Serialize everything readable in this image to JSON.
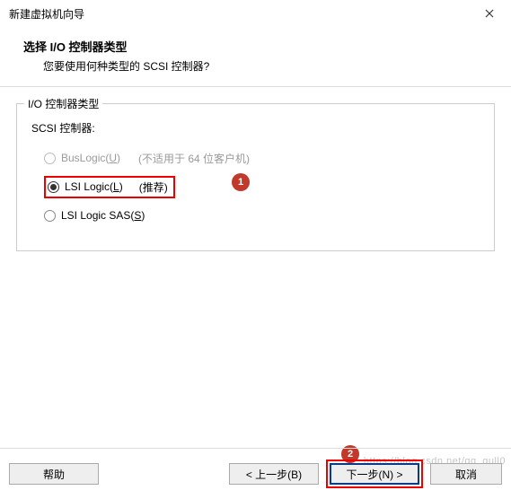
{
  "titlebar": {
    "title": "新建虚拟机向导"
  },
  "header": {
    "title": "选择 I/O 控制器类型",
    "subtitle": "您要使用何种类型的 SCSI 控制器?"
  },
  "group": {
    "legend": "I/O 控制器类型",
    "scsi_label": "SCSI 控制器:",
    "options": {
      "buslogic": {
        "label_pre": "BusLogic(",
        "key": "U",
        "label_post": ")",
        "hint": "(不适用于 64 位客户机)"
      },
      "lsilogic": {
        "label_pre": "LSI Logic(",
        "key": "L",
        "label_post": ")",
        "hint": "(推荐)"
      },
      "lsisas": {
        "label_pre": "LSI Logic SAS(",
        "key": "S",
        "label_post": ")"
      }
    }
  },
  "callouts": {
    "one": "1",
    "two": "2"
  },
  "footer": {
    "help": "帮助",
    "back": "< 上一步(B)",
    "next": "下一步(N) >",
    "cancel": "取消"
  },
  "watermark": "https://blog.csdn.net/qq_gull0"
}
